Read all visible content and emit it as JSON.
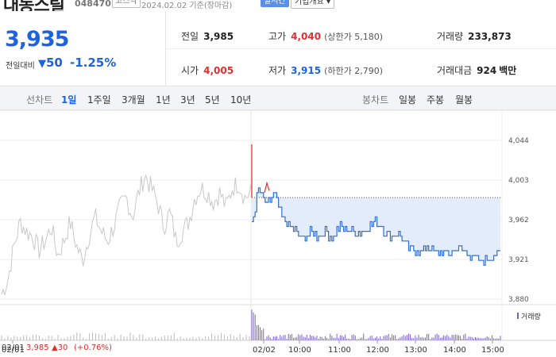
{
  "header": {
    "name": "대동스틸",
    "code": "048470",
    "market": "코스닥",
    "date_note": "2024.02.02 기준(장마감)",
    "realtime_button": "실시간",
    "overview_button": "기업개요 ▾"
  },
  "price": {
    "current": "3,935",
    "change_label": "전일대비",
    "change_value": "50",
    "change_pct": "-1.25%"
  },
  "stats": {
    "prev_close": {
      "label": "전일",
      "value": "3,985"
    },
    "high": {
      "label": "고가",
      "value": "4,040",
      "sub": "(상한가 5,180)"
    },
    "volume": {
      "label": "거래량",
      "value": "233,873"
    },
    "open": {
      "label": "시가",
      "value": "4,005"
    },
    "low": {
      "label": "저가",
      "value": "3,915",
      "sub": "(하한가 2,790)"
    },
    "amount": {
      "label": "거래대금",
      "value": "924",
      "unit": "백만"
    }
  },
  "tabs": {
    "line_label": "선차트",
    "periods": [
      "1일",
      "1주일",
      "3개월",
      "1년",
      "3년",
      "5년",
      "10년"
    ],
    "selected": "1일",
    "candle_label": "봉차트",
    "candles": [
      "일봉",
      "주봉",
      "월봉"
    ]
  },
  "chart_data": {
    "type": "line",
    "y_ticks": [
      "4,044",
      "4,003",
      "3,962",
      "3,921",
      "3,880"
    ],
    "ylim": [
      3880,
      4044
    ],
    "x_ticks": [
      "02/01",
      "02/02",
      "10:00",
      "11:00",
      "12:00",
      "13:00",
      "14:00",
      "15:00"
    ],
    "prev_close": 3985,
    "volume_label": "거래량",
    "colors": {
      "prev_day": "#c8c8c8",
      "today": "#2e6fd8",
      "fill": "#e3ecfb",
      "up": "#e22d2d"
    }
  },
  "footer": {
    "date": "02/01",
    "price": "3,985",
    "change": "▲30",
    "pct": "(+0.76%)"
  }
}
